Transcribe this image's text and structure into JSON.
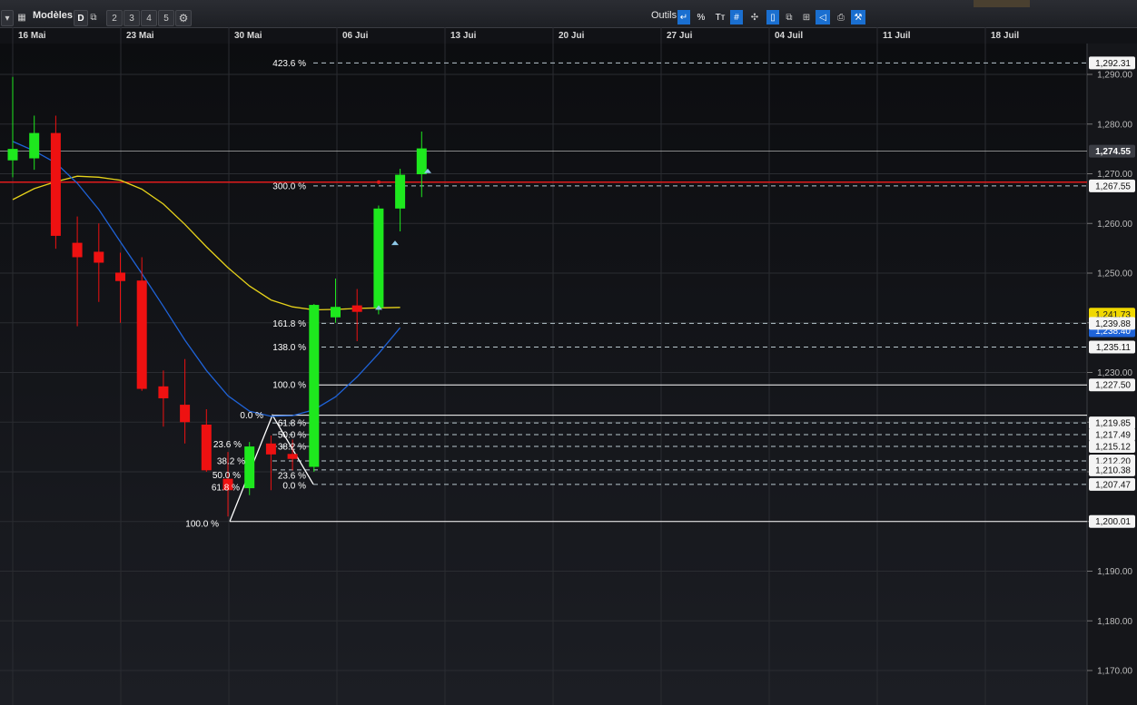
{
  "toolbar": {
    "modeles_label": "Modèles",
    "timeframe_label": "D",
    "layout_buttons": [
      "2",
      "3",
      "4",
      "5"
    ],
    "outils_label": "Outils",
    "percent_label": "%",
    "text_tool_label": "Tт"
  },
  "colors": {
    "background": "#111216",
    "grid": "#2a2c31",
    "bull": "#1ee81e",
    "bear": "#ee1111",
    "ma_yellow": "#e6d21a",
    "ma_blue": "#1f63d8",
    "price_line_red": "#e01b1b",
    "fib_dashed": "#b9c8cf",
    "fib_solid": "#ffffff"
  },
  "chart_data": {
    "type": "candlestick",
    "x_labels": [
      "16 Mai",
      "23 Mai",
      "30 Mai",
      "06 Jui",
      "13 Jui",
      "20 Jui",
      "27 Jui",
      "04 Juil",
      "11 Juil",
      "18 Juil"
    ],
    "y_ticks": [
      "1,290.00",
      "1,280.00",
      "1,270.00",
      "1,260.00",
      "1,250.00",
      "1,240.00",
      "1,230.00",
      "1,220.00",
      "1,210.00",
      "1,200.00",
      "1,190.00",
      "1,180.00",
      "1,170.00"
    ],
    "ylim": [
      1164,
      1296
    ],
    "candles": [
      {
        "o": 1272.7,
        "h": 1289.5,
        "l": 1269.3,
        "c": 1275.0
      },
      {
        "o": 1273.1,
        "h": 1281.7,
        "l": 1270.8,
        "c": 1278.2
      },
      {
        "o": 1278.2,
        "h": 1281.7,
        "l": 1254.9,
        "c": 1257.5
      },
      {
        "o": 1256.1,
        "h": 1261.4,
        "l": 1239.3,
        "c": 1253.2
      },
      {
        "o": 1254.3,
        "h": 1260.0,
        "l": 1244.2,
        "c": 1252.1
      },
      {
        "o": 1250.1,
        "h": 1254.1,
        "l": 1240.0,
        "c": 1248.4
      },
      {
        "o": 1248.5,
        "h": 1253.2,
        "l": 1226.3,
        "c": 1226.7
      },
      {
        "o": 1227.2,
        "h": 1230.4,
        "l": 1219.1,
        "c": 1224.8
      },
      {
        "o": 1223.5,
        "h": 1232.7,
        "l": 1215.7,
        "c": 1220.0
      },
      {
        "o": 1219.5,
        "h": 1222.6,
        "l": 1210.0,
        "c": 1210.3
      },
      {
        "o": 1208.6,
        "h": 1214.0,
        "l": 1201.0,
        "c": 1206.3
      },
      {
        "o": 1206.7,
        "h": 1216.0,
        "l": 1205.3,
        "c": 1215.1
      },
      {
        "o": 1215.7,
        "h": 1217.3,
        "l": 1206.3,
        "c": 1213.5
      },
      {
        "o": 1213.6,
        "h": 1216.5,
        "l": 1210.3,
        "c": 1212.6
      },
      {
        "o": 1211.0,
        "h": 1243.8,
        "l": 1210.0,
        "c": 1243.6
      },
      {
        "o": 1241.1,
        "h": 1248.9,
        "l": 1240.0,
        "c": 1243.2
      },
      {
        "o": 1243.5,
        "h": 1246.8,
        "l": 1236.3,
        "c": 1242.2
      },
      {
        "o": 1243.0,
        "h": 1263.6,
        "l": 1241.7,
        "c": 1263.0
      },
      {
        "o": 1263.0,
        "h": 1271.0,
        "l": 1258.4,
        "c": 1269.8
      },
      {
        "o": 1269.9,
        "h": 1278.5,
        "l": 1265.3,
        "c": 1275.1
      }
    ],
    "ma_yellow": [
      1264.8,
      1267.0,
      1268.4,
      1269.5,
      1269.3,
      1268.7,
      1266.9,
      1263.9,
      1259.8,
      1255.3,
      1251.1,
      1247.4,
      1244.6,
      1243.2,
      1242.6,
      1242.7,
      1242.9,
      1243.0,
      1243.1
    ],
    "ma_blue": [
      1276.5,
      1274.6,
      1272.2,
      1268.1,
      1262.8,
      1256.3,
      1249.9,
      1243.3,
      1236.5,
      1230.4,
      1225.3,
      1222.2,
      1221.2,
      1221.3,
      1222.5,
      1225.1,
      1229.1,
      1233.8,
      1239.0
    ],
    "price_labels": {
      "fib_423": "1,292.31",
      "last": "1,274.55",
      "fib_300": "1,267.55",
      "ma_yellow_tag": "1,241.73",
      "fib_161": "1,239.88",
      "ma_blue_tag": "1,238.40",
      "fib_138": "1,235.11",
      "fib_100": "1,227.50",
      "r_618": "1,219.85",
      "r_500": "1,217.49",
      "r_382": "1,215.12",
      "r_236": "1,212.20",
      "r_0b": "1,210.38",
      "r_0": "1,207.47",
      "low": "1,200.01"
    },
    "fib_labels": {
      "p423": "423.6 %",
      "p300": "300.0 %",
      "p161": "161.8 %",
      "p138": "138.0 %",
      "p100": "100.0 %",
      "q0": "0.0 %",
      "q618": "61.8 %",
      "q500": "50.0 %",
      "q382": "38.2 %",
      "q236": "23.6 %",
      "q00": "0.0 %",
      "a236": "23.6 %",
      "a382": "38.2 %",
      "a500": "50.0 %",
      "a618": "61.8 %",
      "a100": "100.0 %"
    }
  }
}
